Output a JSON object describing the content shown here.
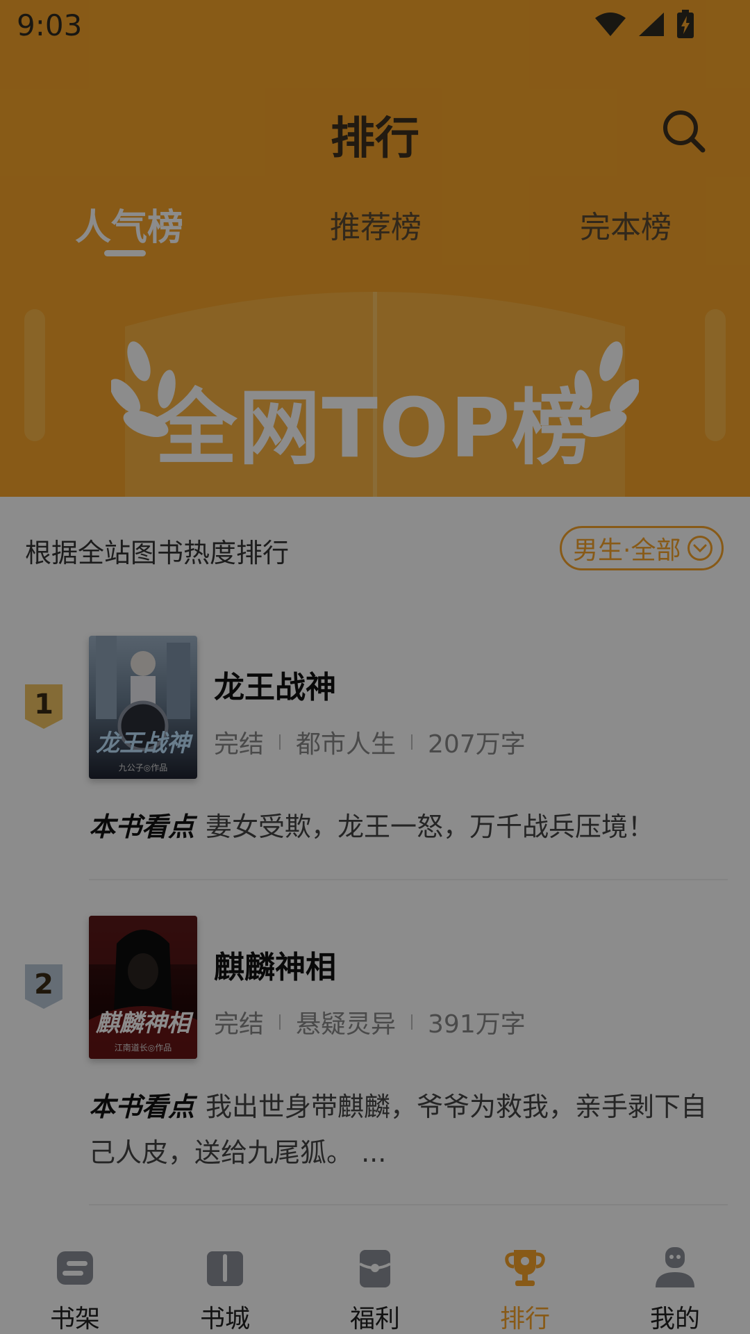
{
  "status_bar": {
    "time": "9:03"
  },
  "header": {
    "title": "排行",
    "tabs": [
      {
        "label": "人气榜",
        "active": true
      },
      {
        "label": "推荐榜",
        "active": false
      },
      {
        "label": "完本榜",
        "active": false
      }
    ],
    "banner_text": "全网TOP榜"
  },
  "content": {
    "subtitle": "根据全站图书热度排行",
    "filter_label": "男生·全部",
    "books": [
      {
        "rank": "1",
        "title": "龙王战神",
        "status": "完结",
        "genre": "都市人生",
        "words": "207万字",
        "cover_title": "龙王战神",
        "cover_author": "九公子◎作品",
        "highlight_label": "本书看点",
        "highlight": "妻女受欺，龙王一怒，万千战兵压境！"
      },
      {
        "rank": "2",
        "title": "麒麟神相",
        "status": "完结",
        "genre": "悬疑灵异",
        "words": "391万字",
        "cover_title": "麒麟神相",
        "cover_author": "江南道长◎作品",
        "highlight_label": "本书看点",
        "highlight": "我出世身带麒麟，爷爷为救我，亲手剥下自己人皮，送给九尾狐。 ..."
      }
    ]
  },
  "bottom_nav": [
    {
      "label": "书架",
      "icon": "bookshelf-icon",
      "active": false
    },
    {
      "label": "书城",
      "icon": "book-icon",
      "active": false
    },
    {
      "label": "福利",
      "icon": "gift-icon",
      "active": false
    },
    {
      "label": "排行",
      "icon": "trophy-icon",
      "active": true
    },
    {
      "label": "我的",
      "icon": "profile-icon",
      "active": false
    }
  ],
  "colors": {
    "accent": "#f7a52a",
    "overlay": "rgba(0,0,0,0.45)"
  }
}
